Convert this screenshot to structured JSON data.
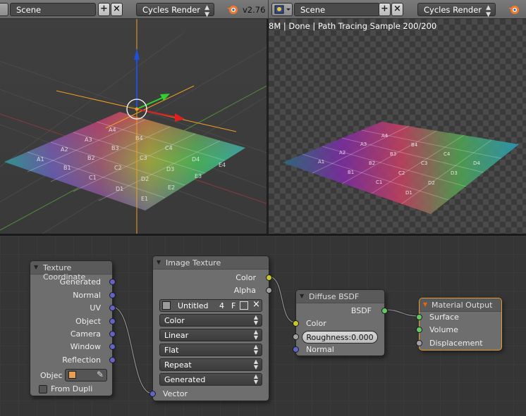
{
  "header_left": {
    "scene_field": "Scene",
    "render_engine": "Cycles Render",
    "version": "v2.76",
    "icons": [
      "editor-type-icon",
      "add-scene-icon",
      "close-scene-icon",
      "blender-logo-icon"
    ]
  },
  "header_right": {
    "scene_field": "Scene",
    "render_engine": "Cycles Render",
    "icons": [
      "editor-type-icon",
      "add-scene-icon",
      "close-scene-icon",
      "blender-logo-icon"
    ]
  },
  "render_view": {
    "status": "8M | Done | Path Tracing Sample 200/200"
  },
  "grid_labels": [
    "A1",
    "A2",
    "A3",
    "A4",
    "A5",
    "B1",
    "B2",
    "B3",
    "B4",
    "B5",
    "C1",
    "C2",
    "C3",
    "C4",
    "C5",
    "D1",
    "D2",
    "D3",
    "D4",
    "D5",
    "E1",
    "E2",
    "E3",
    "E4",
    "E5"
  ],
  "nodes": {
    "texture_coordinate": {
      "title": "Texture Coordinate",
      "outputs": [
        "Generated",
        "Normal",
        "UV",
        "Object",
        "Camera",
        "Window",
        "Reflection"
      ],
      "object_label": "Objec",
      "from_dupli_label": "From Dupli",
      "from_dupli_checked": false
    },
    "image_texture": {
      "title": "Image Texture",
      "outputs": [
        "Color",
        "Alpha"
      ],
      "image_name": "Untitled",
      "users": "4",
      "fake_user": "F",
      "color_space": "Color",
      "interpolation": "Linear",
      "projection": "Flat",
      "extension": "Repeat",
      "source": "Generated",
      "input_vector": "Vector"
    },
    "diffuse_bsdf": {
      "title": "Diffuse BSDF",
      "output": "BSDF",
      "input_color": "Color",
      "roughness": "Roughness:0.000",
      "input_normal": "Normal"
    },
    "material_output": {
      "title": "Material Output",
      "inputs": [
        "Surface",
        "Volume",
        "Displacement"
      ]
    }
  },
  "colors": {
    "vector_socket": "#6363c7",
    "color_socket": "#c7c729",
    "shader_socket": "#63c763",
    "float_socket": "#a1a1a1",
    "active_node_border": "#e89a2c"
  }
}
